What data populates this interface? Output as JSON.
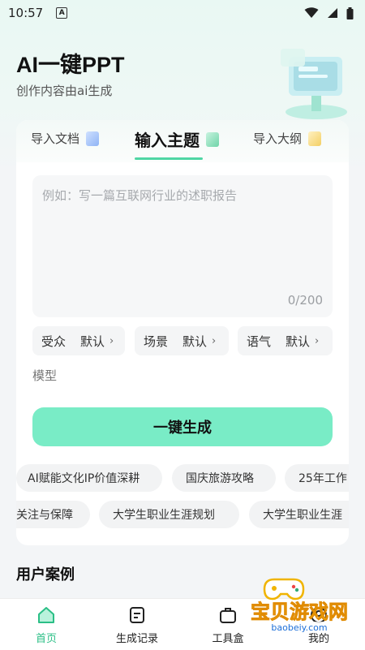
{
  "status_bar": {
    "time": "10:57",
    "notification_letter": "A"
  },
  "hero": {
    "title": "AI一键PPT",
    "subtitle": "创作内容由ai生成"
  },
  "tabs": [
    {
      "label": "导入文档",
      "active": false
    },
    {
      "label": "输入主题",
      "active": true
    },
    {
      "label": "导入大纲",
      "active": false
    }
  ],
  "topic_input": {
    "placeholder": "例如：写一篇互联网行业的述职报告",
    "counter": "0/200"
  },
  "options": [
    {
      "label": "受众",
      "value": "默认"
    },
    {
      "label": "场景",
      "value": "默认"
    },
    {
      "label": "语气",
      "value": "默认"
    }
  ],
  "model_label": "模型",
  "generate_button": "一键生成",
  "suggestions_row1": [
    "AI赋能文化IP价值深耕",
    "国庆旅游攻略",
    "25年工作"
  ],
  "suggestions_row2": [
    "关注与保障",
    "大学生职业生涯规划",
    "大学生职业生涯"
  ],
  "section_title": "用户案例",
  "nav": [
    {
      "label": "首页",
      "icon": "home-icon",
      "active": true
    },
    {
      "label": "生成记录",
      "icon": "document-icon",
      "active": false
    },
    {
      "label": "工具盒",
      "icon": "toolbox-icon",
      "active": false
    },
    {
      "label": "我的",
      "icon": "profile-icon",
      "active": false
    }
  ],
  "watermark": {
    "text": "宝贝游戏网",
    "url": "baobeiy.com"
  },
  "colors": {
    "accent": "#79ecc6",
    "accent_dark": "#2bbf86",
    "background": "#f3f5f7"
  }
}
